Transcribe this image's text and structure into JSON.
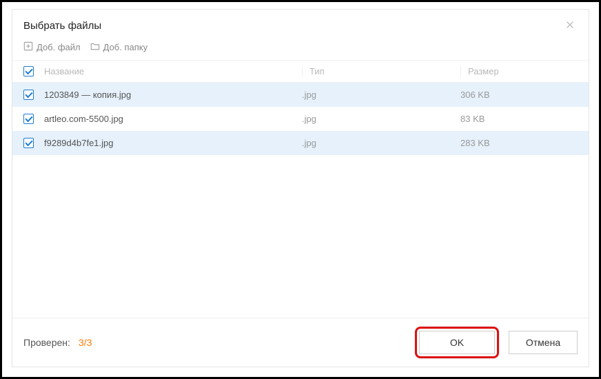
{
  "dialog": {
    "title": "Выбрать файлы"
  },
  "toolbar": {
    "add_file_label": "Доб. файл",
    "add_folder_label": "Доб. папку"
  },
  "columns": {
    "name": "Название",
    "type": "Тип",
    "size": "Размер"
  },
  "files": [
    {
      "checked": true,
      "name": "1203849 — копия.jpg",
      "type": ".jpg",
      "size": "306 KB"
    },
    {
      "checked": true,
      "name": "artleo.com-5500.jpg",
      "type": ".jpg",
      "size": "83 KB"
    },
    {
      "checked": true,
      "name": "f9289d4b7fe1.jpg",
      "type": ".jpg",
      "size": "283 KB"
    }
  ],
  "header_checked": true,
  "footer": {
    "checked_label": "Проверен:",
    "count": "3/3",
    "ok_label": "OK",
    "cancel_label": "Отмена"
  }
}
